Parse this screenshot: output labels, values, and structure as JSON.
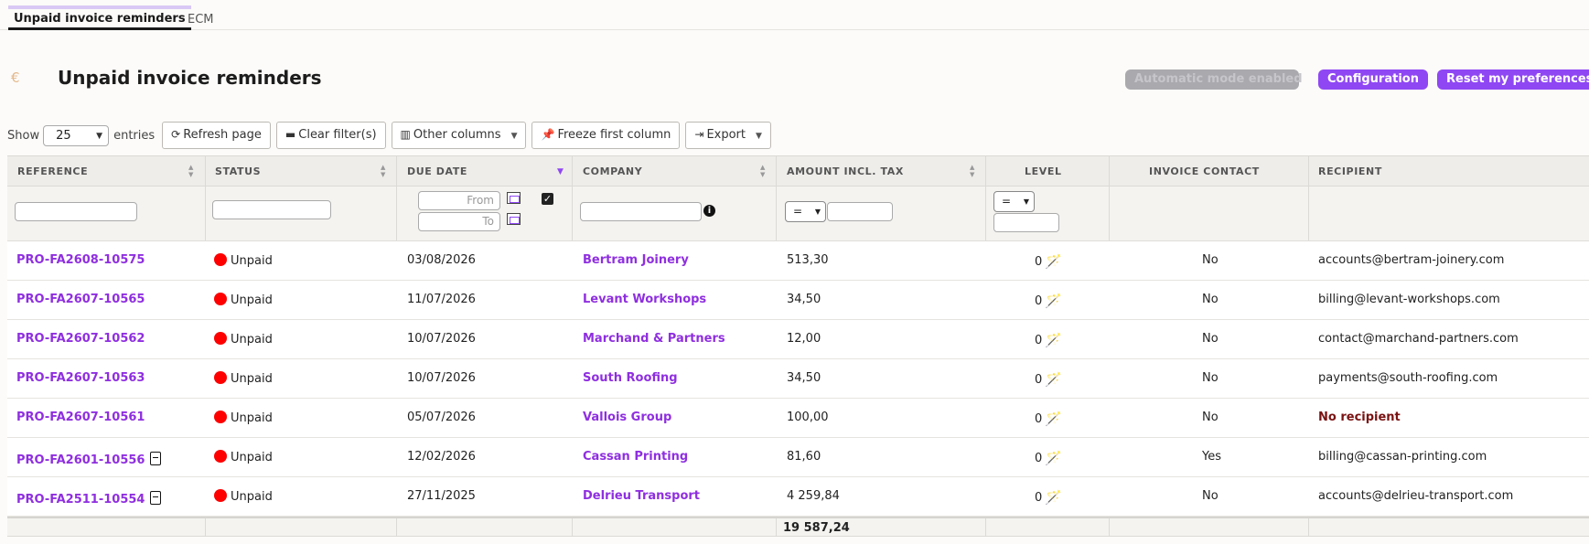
{
  "tabs": [
    {
      "label": "Unpaid invoice reminders",
      "active": true
    },
    {
      "label": "ECM",
      "active": false
    }
  ],
  "header": {
    "currency_icon": "€",
    "title": "Unpaid invoice reminders",
    "auto_mode_label": "Automatic mode enabled",
    "configuration_label": "Configuration",
    "reset_label": "Reset my preferences"
  },
  "toolbar": {
    "show_label": "Show",
    "entries_value": "25",
    "entries_label": "entries",
    "refresh_label": "Refresh page",
    "clear_label": "Clear filter(s)",
    "other_columns_label": "Other columns",
    "freeze_label": "Freeze first column",
    "export_label": "Export"
  },
  "columns": {
    "reference": "REFERENCE",
    "status": "STATUS",
    "due_date": "DUE DATE",
    "company": "COMPANY",
    "amount": "AMOUNT INCL. TAX",
    "level": "LEVEL",
    "invoice_contact": "INVOICE CONTACT",
    "recipient": "RECIPIENT"
  },
  "filters": {
    "date_from_placeholder": "From",
    "date_to_placeholder": "To",
    "amount_operator": "=",
    "level_operator": "="
  },
  "rows": [
    {
      "reference": "PRO-FA2608-10575",
      "pdf": false,
      "status": "Unpaid",
      "due_date": "03/08/2026",
      "company": "Bertram Joinery",
      "amount": "513,30",
      "level": "0",
      "invoice_contact": "No",
      "recipient": "accounts@bertram-joinery.com",
      "no_recipient": false
    },
    {
      "reference": "PRO-FA2607-10565",
      "pdf": false,
      "status": "Unpaid",
      "due_date": "11/07/2026",
      "company": "Levant Workshops",
      "amount": "34,50",
      "level": "0",
      "invoice_contact": "No",
      "recipient": "billing@levant-workshops.com",
      "no_recipient": false
    },
    {
      "reference": "PRO-FA2607-10562",
      "pdf": false,
      "status": "Unpaid",
      "due_date": "10/07/2026",
      "company": "Marchand & Partners",
      "amount": "12,00",
      "level": "0",
      "invoice_contact": "No",
      "recipient": "contact@marchand-partners.com",
      "no_recipient": false
    },
    {
      "reference": "PRO-FA2607-10563",
      "pdf": false,
      "status": "Unpaid",
      "due_date": "10/07/2026",
      "company": "South Roofing",
      "amount": "34,50",
      "level": "0",
      "invoice_contact": "No",
      "recipient": "payments@south-roofing.com",
      "no_recipient": false
    },
    {
      "reference": "PRO-FA2607-10561",
      "pdf": false,
      "status": "Unpaid",
      "due_date": "05/07/2026",
      "company": "Vallois Group",
      "amount": "100,00",
      "level": "0",
      "invoice_contact": "No",
      "recipient": "No recipient",
      "no_recipient": true
    },
    {
      "reference": "PRO-FA2601-10556",
      "pdf": true,
      "status": "Unpaid",
      "due_date": "12/02/2026",
      "company": "Cassan Printing",
      "amount": "81,60",
      "level": "0",
      "invoice_contact": "Yes",
      "recipient": "billing@cassan-printing.com",
      "no_recipient": false
    },
    {
      "reference": "PRO-FA2511-10554",
      "pdf": true,
      "status": "Unpaid",
      "due_date": "27/11/2025",
      "company": "Delrieu Transport",
      "amount": "4 259,84",
      "level": "0",
      "invoice_contact": "No",
      "recipient": "accounts@delrieu-transport.com",
      "no_recipient": false
    }
  ],
  "totals": {
    "amount": "19 587,24"
  },
  "colors": {
    "accent": "#8f47f3",
    "status_unpaid": "#ff0000",
    "no_recipient": "#7a1212"
  }
}
